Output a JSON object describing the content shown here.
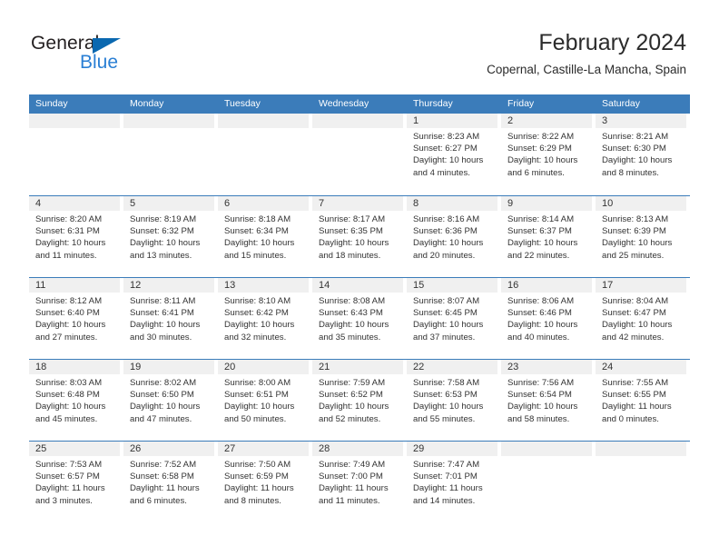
{
  "brand": {
    "name_top": "General",
    "name_bottom": "Blue",
    "logo_color": "#0a68b0",
    "logo_text_color": "#2a7fd4"
  },
  "header": {
    "title": "February 2024",
    "subtitle": "Copernal, Castille-La Mancha, Spain"
  },
  "theme": {
    "header_blue": "#3b7cba",
    "daynum_band": "#f0f0f0",
    "text": "#333333"
  },
  "calendar": {
    "weekday_headers": [
      "Sunday",
      "Monday",
      "Tuesday",
      "Wednesday",
      "Thursday",
      "Friday",
      "Saturday"
    ],
    "weeks": [
      [
        {
          "day": "",
          "empty": true,
          "sunrise": "",
          "sunset": "",
          "daylight1": "",
          "daylight2": ""
        },
        {
          "day": "",
          "empty": true,
          "sunrise": "",
          "sunset": "",
          "daylight1": "",
          "daylight2": ""
        },
        {
          "day": "",
          "empty": true,
          "sunrise": "",
          "sunset": "",
          "daylight1": "",
          "daylight2": ""
        },
        {
          "day": "",
          "empty": true,
          "sunrise": "",
          "sunset": "",
          "daylight1": "",
          "daylight2": ""
        },
        {
          "day": "1",
          "sunrise": "Sunrise: 8:23 AM",
          "sunset": "Sunset: 6:27 PM",
          "daylight1": "Daylight: 10 hours",
          "daylight2": "and 4 minutes."
        },
        {
          "day": "2",
          "sunrise": "Sunrise: 8:22 AM",
          "sunset": "Sunset: 6:29 PM",
          "daylight1": "Daylight: 10 hours",
          "daylight2": "and 6 minutes."
        },
        {
          "day": "3",
          "sunrise": "Sunrise: 8:21 AM",
          "sunset": "Sunset: 6:30 PM",
          "daylight1": "Daylight: 10 hours",
          "daylight2": "and 8 minutes."
        }
      ],
      [
        {
          "day": "4",
          "sunrise": "Sunrise: 8:20 AM",
          "sunset": "Sunset: 6:31 PM",
          "daylight1": "Daylight: 10 hours",
          "daylight2": "and 11 minutes."
        },
        {
          "day": "5",
          "sunrise": "Sunrise: 8:19 AM",
          "sunset": "Sunset: 6:32 PM",
          "daylight1": "Daylight: 10 hours",
          "daylight2": "and 13 minutes."
        },
        {
          "day": "6",
          "sunrise": "Sunrise: 8:18 AM",
          "sunset": "Sunset: 6:34 PM",
          "daylight1": "Daylight: 10 hours",
          "daylight2": "and 15 minutes."
        },
        {
          "day": "7",
          "sunrise": "Sunrise: 8:17 AM",
          "sunset": "Sunset: 6:35 PM",
          "daylight1": "Daylight: 10 hours",
          "daylight2": "and 18 minutes."
        },
        {
          "day": "8",
          "sunrise": "Sunrise: 8:16 AM",
          "sunset": "Sunset: 6:36 PM",
          "daylight1": "Daylight: 10 hours",
          "daylight2": "and 20 minutes."
        },
        {
          "day": "9",
          "sunrise": "Sunrise: 8:14 AM",
          "sunset": "Sunset: 6:37 PM",
          "daylight1": "Daylight: 10 hours",
          "daylight2": "and 22 minutes."
        },
        {
          "day": "10",
          "sunrise": "Sunrise: 8:13 AM",
          "sunset": "Sunset: 6:39 PM",
          "daylight1": "Daylight: 10 hours",
          "daylight2": "and 25 minutes."
        }
      ],
      [
        {
          "day": "11",
          "sunrise": "Sunrise: 8:12 AM",
          "sunset": "Sunset: 6:40 PM",
          "daylight1": "Daylight: 10 hours",
          "daylight2": "and 27 minutes."
        },
        {
          "day": "12",
          "sunrise": "Sunrise: 8:11 AM",
          "sunset": "Sunset: 6:41 PM",
          "daylight1": "Daylight: 10 hours",
          "daylight2": "and 30 minutes."
        },
        {
          "day": "13",
          "sunrise": "Sunrise: 8:10 AM",
          "sunset": "Sunset: 6:42 PM",
          "daylight1": "Daylight: 10 hours",
          "daylight2": "and 32 minutes."
        },
        {
          "day": "14",
          "sunrise": "Sunrise: 8:08 AM",
          "sunset": "Sunset: 6:43 PM",
          "daylight1": "Daylight: 10 hours",
          "daylight2": "and 35 minutes."
        },
        {
          "day": "15",
          "sunrise": "Sunrise: 8:07 AM",
          "sunset": "Sunset: 6:45 PM",
          "daylight1": "Daylight: 10 hours",
          "daylight2": "and 37 minutes."
        },
        {
          "day": "16",
          "sunrise": "Sunrise: 8:06 AM",
          "sunset": "Sunset: 6:46 PM",
          "daylight1": "Daylight: 10 hours",
          "daylight2": "and 40 minutes."
        },
        {
          "day": "17",
          "sunrise": "Sunrise: 8:04 AM",
          "sunset": "Sunset: 6:47 PM",
          "daylight1": "Daylight: 10 hours",
          "daylight2": "and 42 minutes."
        }
      ],
      [
        {
          "day": "18",
          "sunrise": "Sunrise: 8:03 AM",
          "sunset": "Sunset: 6:48 PM",
          "daylight1": "Daylight: 10 hours",
          "daylight2": "and 45 minutes."
        },
        {
          "day": "19",
          "sunrise": "Sunrise: 8:02 AM",
          "sunset": "Sunset: 6:50 PM",
          "daylight1": "Daylight: 10 hours",
          "daylight2": "and 47 minutes."
        },
        {
          "day": "20",
          "sunrise": "Sunrise: 8:00 AM",
          "sunset": "Sunset: 6:51 PM",
          "daylight1": "Daylight: 10 hours",
          "daylight2": "and 50 minutes."
        },
        {
          "day": "21",
          "sunrise": "Sunrise: 7:59 AM",
          "sunset": "Sunset: 6:52 PM",
          "daylight1": "Daylight: 10 hours",
          "daylight2": "and 52 minutes."
        },
        {
          "day": "22",
          "sunrise": "Sunrise: 7:58 AM",
          "sunset": "Sunset: 6:53 PM",
          "daylight1": "Daylight: 10 hours",
          "daylight2": "and 55 minutes."
        },
        {
          "day": "23",
          "sunrise": "Sunrise: 7:56 AM",
          "sunset": "Sunset: 6:54 PM",
          "daylight1": "Daylight: 10 hours",
          "daylight2": "and 58 minutes."
        },
        {
          "day": "24",
          "sunrise": "Sunrise: 7:55 AM",
          "sunset": "Sunset: 6:55 PM",
          "daylight1": "Daylight: 11 hours",
          "daylight2": "and 0 minutes."
        }
      ],
      [
        {
          "day": "25",
          "sunrise": "Sunrise: 7:53 AM",
          "sunset": "Sunset: 6:57 PM",
          "daylight1": "Daylight: 11 hours",
          "daylight2": "and 3 minutes."
        },
        {
          "day": "26",
          "sunrise": "Sunrise: 7:52 AM",
          "sunset": "Sunset: 6:58 PM",
          "daylight1": "Daylight: 11 hours",
          "daylight2": "and 6 minutes."
        },
        {
          "day": "27",
          "sunrise": "Sunrise: 7:50 AM",
          "sunset": "Sunset: 6:59 PM",
          "daylight1": "Daylight: 11 hours",
          "daylight2": "and 8 minutes."
        },
        {
          "day": "28",
          "sunrise": "Sunrise: 7:49 AM",
          "sunset": "Sunset: 7:00 PM",
          "daylight1": "Daylight: 11 hours",
          "daylight2": "and 11 minutes."
        },
        {
          "day": "29",
          "sunrise": "Sunrise: 7:47 AM",
          "sunset": "Sunset: 7:01 PM",
          "daylight1": "Daylight: 11 hours",
          "daylight2": "and 14 minutes."
        },
        {
          "day": "",
          "empty": true,
          "sunrise": "",
          "sunset": "",
          "daylight1": "",
          "daylight2": ""
        },
        {
          "day": "",
          "empty": true,
          "sunrise": "",
          "sunset": "",
          "daylight1": "",
          "daylight2": ""
        }
      ]
    ]
  }
}
